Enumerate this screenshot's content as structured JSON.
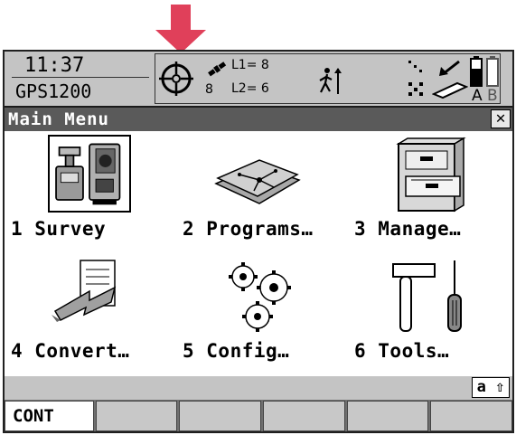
{
  "status": {
    "time": "11:37",
    "device": "GPS1200",
    "sat_count": "8",
    "l1": "L1= 8",
    "l2": "L2= 6",
    "batt_a": "A",
    "batt_b": "B"
  },
  "title": {
    "text": "Main Menu",
    "close": "✕"
  },
  "menu": {
    "items": [
      {
        "label": "1 Survey",
        "icon": "survey-instruments-icon"
      },
      {
        "label": "2 Programs…",
        "icon": "programs-icon"
      },
      {
        "label": "3 Manage…",
        "icon": "file-cabinet-icon"
      },
      {
        "label": "4 Convert…",
        "icon": "convert-icon"
      },
      {
        "label": "5 Config…",
        "icon": "gears-icon"
      },
      {
        "label": "6 Tools…",
        "icon": "tools-icon"
      }
    ]
  },
  "input_mode": "a ⇧",
  "fkeys": [
    "CONT",
    "",
    "",
    "",
    "",
    ""
  ],
  "colors": {
    "arrow": "#e0405a",
    "bar": "#c4c4c4",
    "titlebar": "#5a5a5a"
  }
}
